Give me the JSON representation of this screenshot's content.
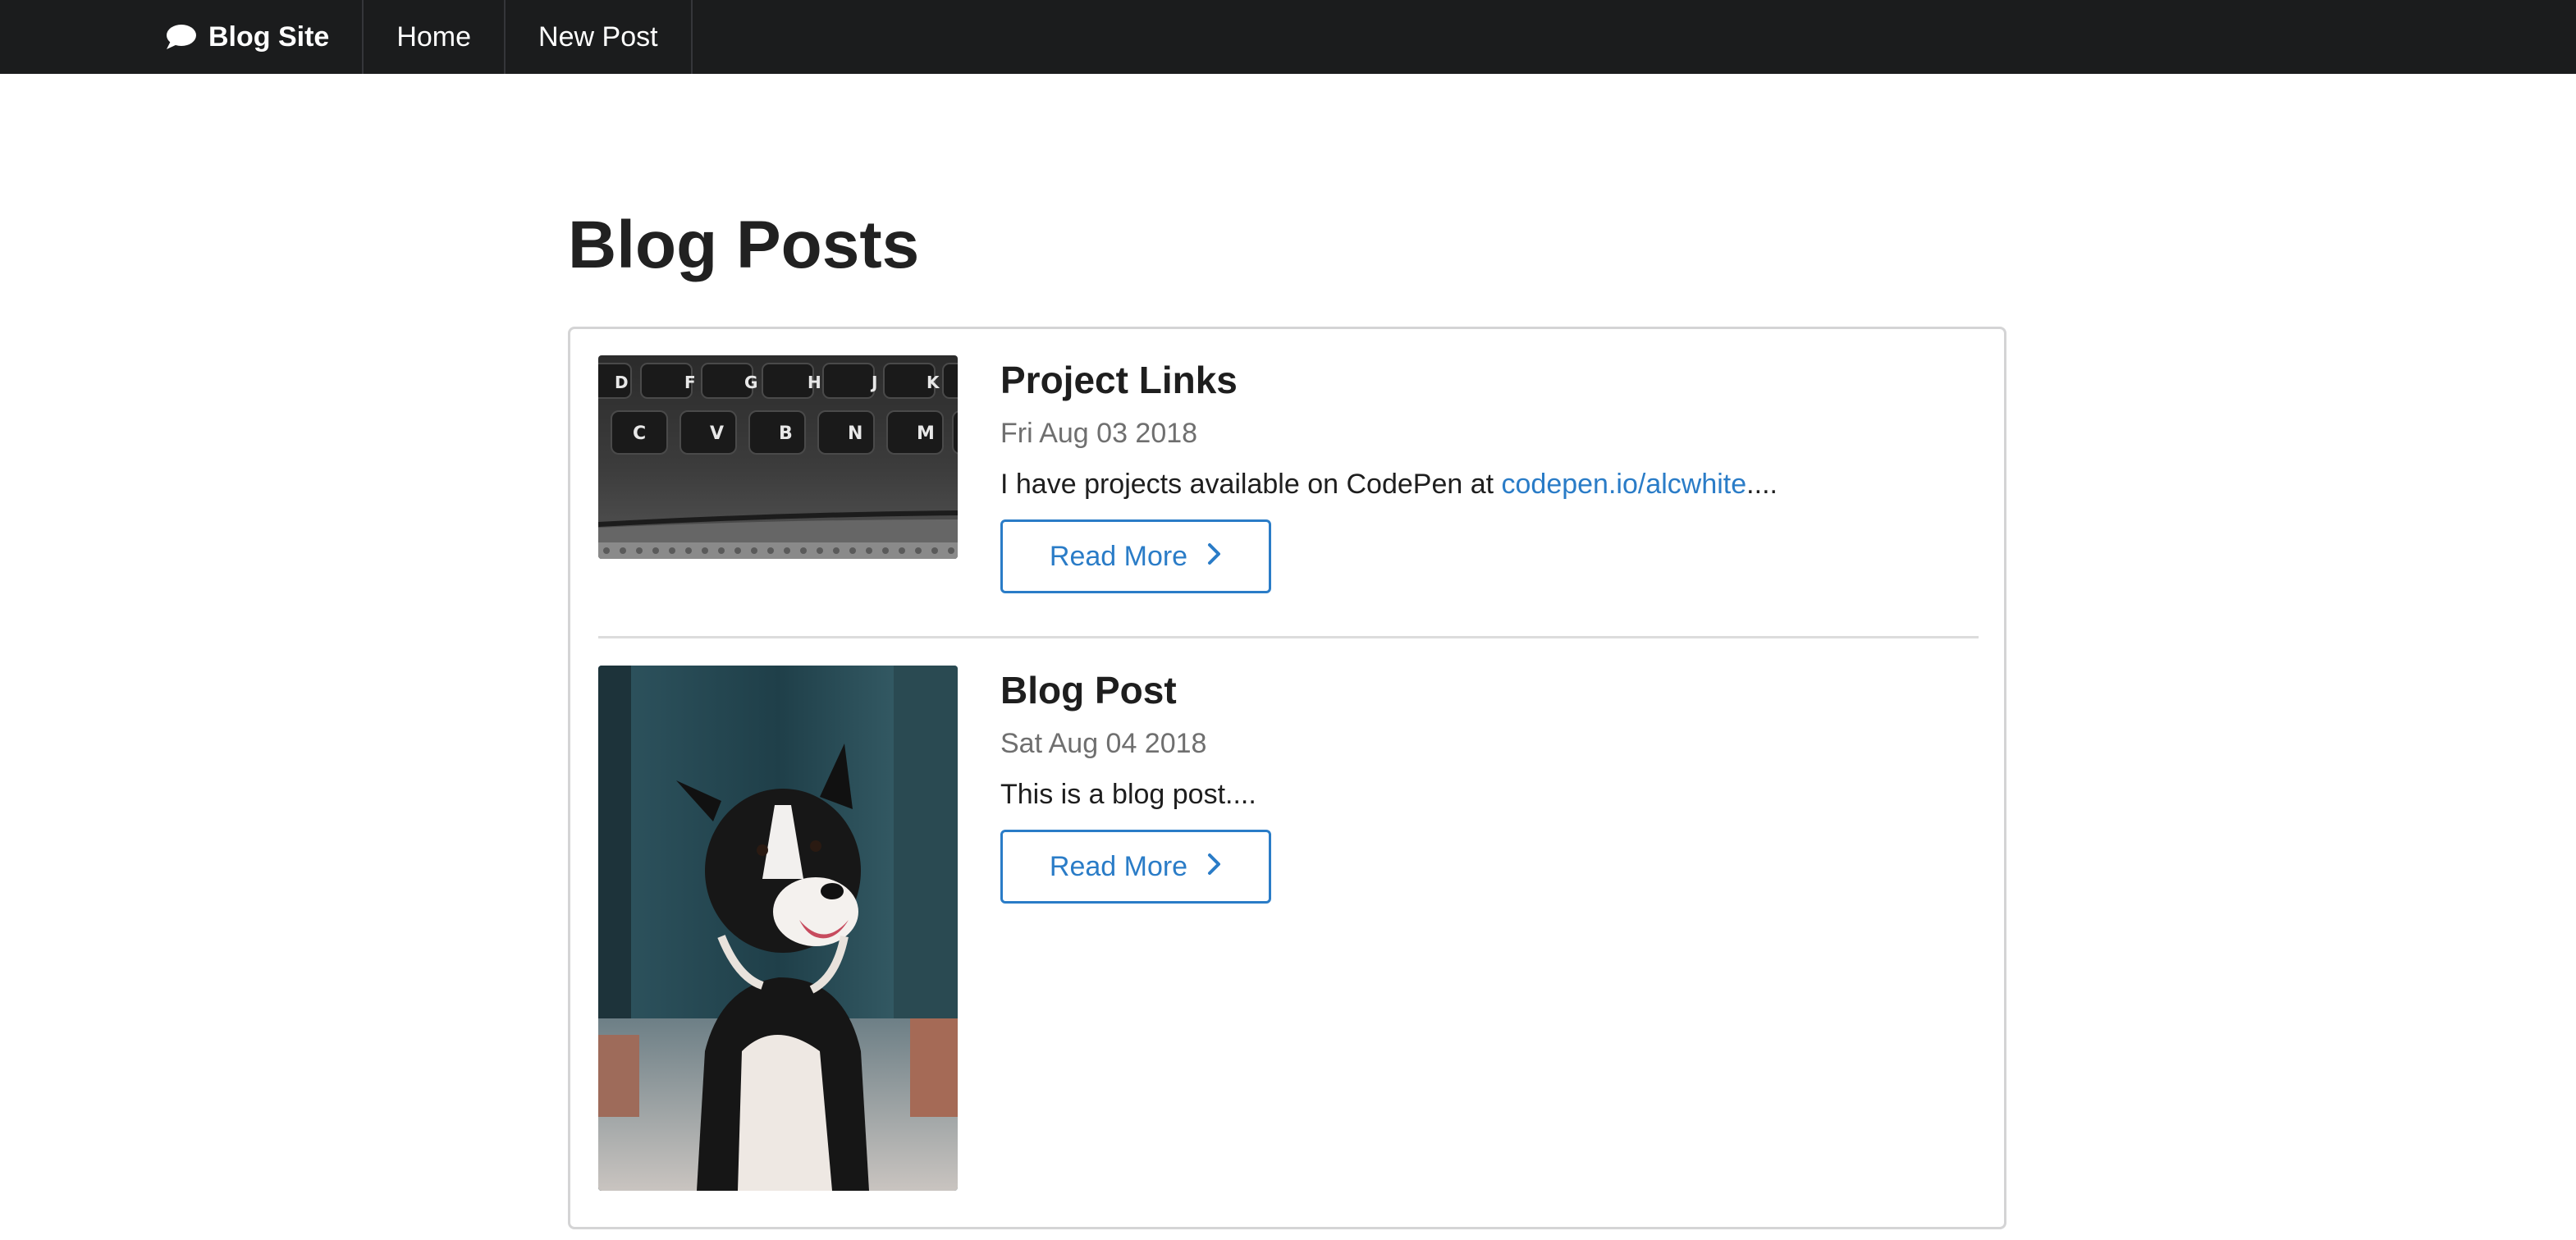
{
  "nav": {
    "brand_label": "Blog Site",
    "brand_icon": "speech-bubble-icon",
    "items": [
      {
        "label": "Home"
      },
      {
        "label": "New Post"
      }
    ]
  },
  "page": {
    "title": "Blog Posts"
  },
  "posts": [
    {
      "title": "Project Links",
      "date": "Fri Aug 03 2018",
      "excerpt_prefix": "I have projects available on CodePen at ",
      "excerpt_link": "codepen.io/alcwhite",
      "excerpt_suffix": "....",
      "read_more_label": "Read More",
      "image": "keyboard-photo"
    },
    {
      "title": "Blog Post",
      "date": "Sat Aug 04 2018",
      "excerpt_prefix": "This is a blog post....",
      "excerpt_link": "",
      "excerpt_suffix": "",
      "read_more_label": "Read More",
      "image": "dog-photo"
    }
  ],
  "colors": {
    "nav_bg": "#1b1c1d",
    "link": "#2a7cc7",
    "muted": "#6f6f6f"
  }
}
